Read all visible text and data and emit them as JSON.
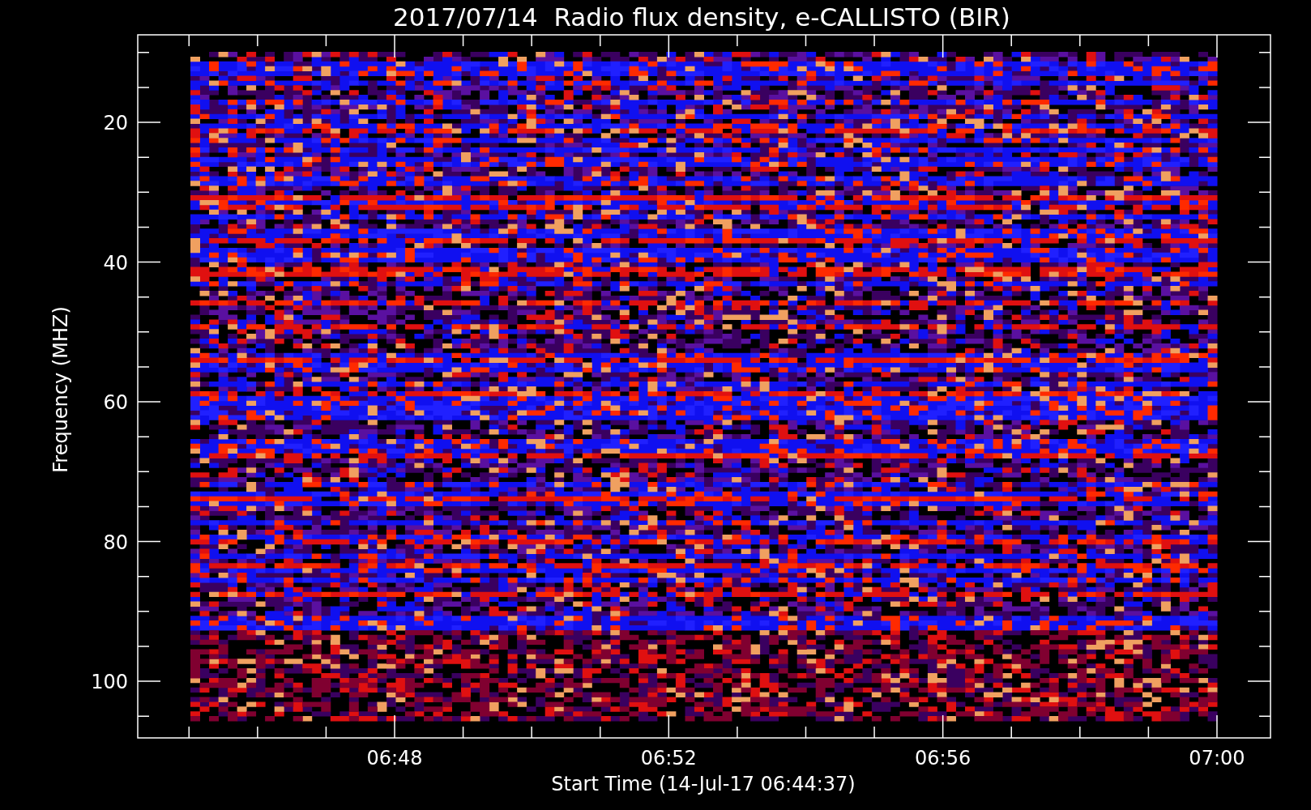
{
  "title": "2017/07/14  Radio flux density, e-CALLISTO (BIR)",
  "y_axis": {
    "label": "Frequency (MHZ)",
    "ticks": [
      "20",
      "40",
      "60",
      "80",
      "100"
    ]
  },
  "x_axis": {
    "label": "Start Time (14-Jul-17 06:44:37)",
    "ticks": [
      "06:48",
      "06:52",
      "06:56",
      "07:00"
    ]
  }
}
